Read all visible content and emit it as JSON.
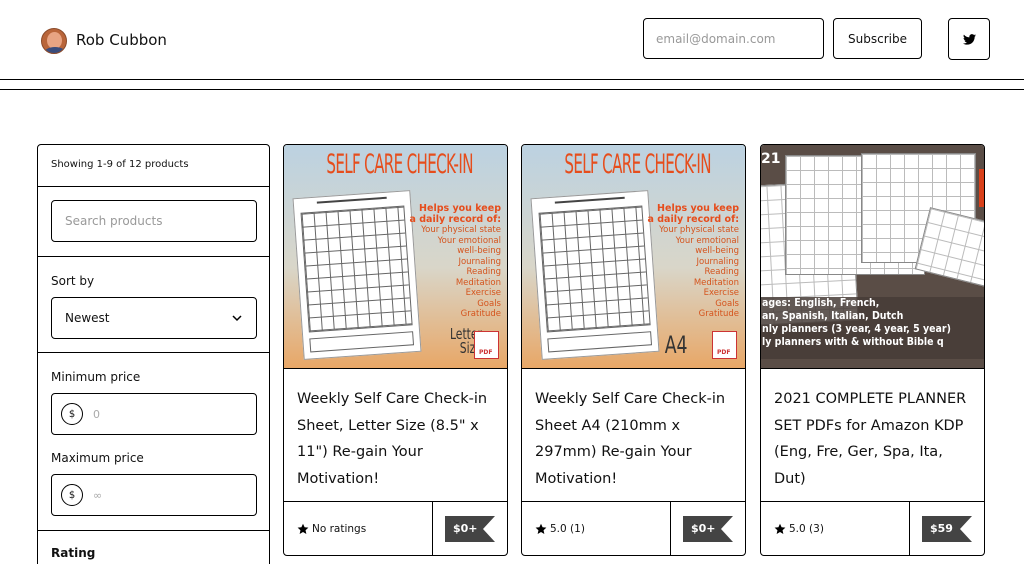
{
  "header": {
    "creator_name": "Rob Cubbon",
    "email_placeholder": "email@domain.com",
    "subscribe_label": "Subscribe"
  },
  "filters": {
    "showing_text": "Showing 1-9 of 12 products",
    "search_placeholder": "Search products",
    "sort_label": "Sort by",
    "sort_value": "Newest",
    "min_price_label": "Minimum price",
    "min_price_value": "0",
    "max_price_label": "Maximum price",
    "max_price_value": "∞",
    "currency_symbol": "$",
    "rating_label": "Rating"
  },
  "products": [
    {
      "title": "Weekly Self Care Check-in Sheet, Letter Size (8.5\" x 11\") Re-gain Your Motivation!",
      "rating": "No ratings",
      "price": "$0+",
      "thumb": {
        "heading": "SELF CARE CHECK-IN",
        "intro": [
          "Helps you keep",
          "a daily record of:"
        ],
        "items": [
          "Your physical state",
          "Your emotional",
          "well-being",
          "Journaling",
          "Reading",
          "Meditation",
          "Exercise",
          "Goals",
          "Gratitude"
        ],
        "size_lines": [
          "Letter",
          "Size"
        ],
        "badge": "PDF"
      }
    },
    {
      "title": "Weekly Self Care Check-in Sheet A4 (210mm x 297mm) Re-gain Your Motivation!",
      "rating": "5.0 (1)",
      "price": "$0+",
      "thumb": {
        "heading": "SELF CARE CHECK-IN",
        "intro": [
          "Helps you keep",
          "a daily record of:"
        ],
        "items": [
          "Your physical state",
          "Your emotional",
          "well-being",
          "Journaling",
          "Reading",
          "Meditation",
          "Exercise",
          "Goals",
          "Gratitude"
        ],
        "size_lines": [
          "A4"
        ],
        "badge": "PDF"
      }
    },
    {
      "title": "2021 COMPLETE PLANNER SET PDFs for Amazon KDP (Eng, Fre, Ger, Spa, Ita, Dut)",
      "rating": "5.0 (3)",
      "price": "$59",
      "thumb": {
        "year": "21",
        "lines": [
          "ages: English, French,",
          "an, Spanish, Italian, Dutch",
          "nly planners (3 year, 4 year, 5 year)",
          "ly planners with & without Bible q"
        ]
      }
    }
  ],
  "colors": {
    "price_tag": "#444444",
    "self_care_orange": "#e64d1c"
  }
}
